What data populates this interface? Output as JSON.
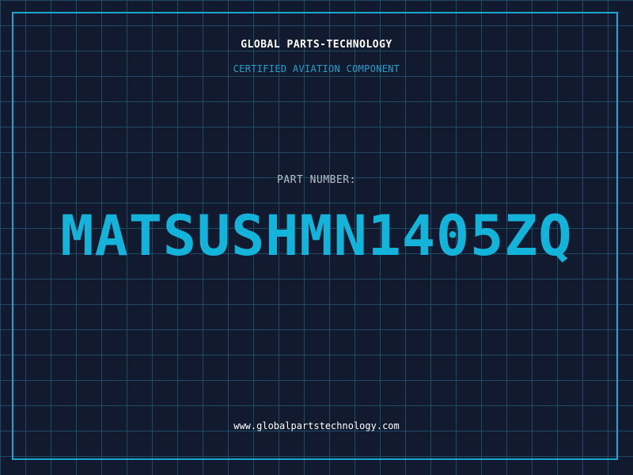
{
  "header": {
    "brand": "GLOBAL PARTS-TECHNOLOGY",
    "tagline": "CERTIFIED AVIATION COMPONENT"
  },
  "part": {
    "label": "PART NUMBER:",
    "number": "MATSUSHMN1405ZQ"
  },
  "footer": {
    "website": "www.globalpartstechnology.com"
  },
  "colors": {
    "background": "#111a2e",
    "grid": "#1f4a63",
    "accent": "#1aa8d0",
    "part_number": "#14b3d9",
    "text_primary": "#ffffff",
    "text_muted": "#b8bfc9"
  }
}
